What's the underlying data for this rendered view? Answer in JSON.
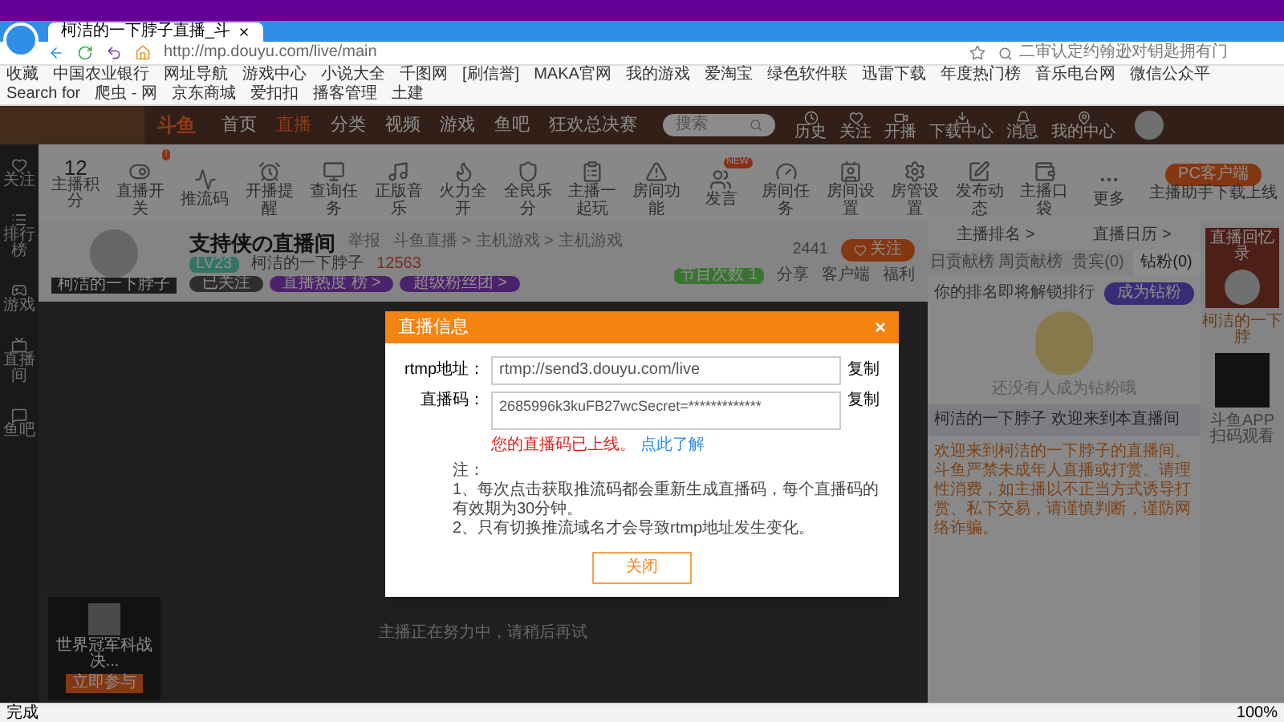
{
  "browser": {
    "tab_title": "柯洁的一下脖子直播_斗",
    "url": "http://mp.douyu.com/live/main",
    "search_placeholder": "二审认定约翰逊对钥匙拥有门",
    "bookmarks": [
      "收藏",
      "中国农业银行",
      "网址导航",
      "游戏中心",
      "小说大全",
      "千图网",
      "[刷信誉]",
      "MAKA官网",
      "我的游戏",
      "爱淘宝",
      "绿色软件联",
      "迅雷下载",
      "年度热门榜",
      "音乐电台网",
      "微信公众平",
      "Search for",
      "爬虫 - 网",
      "京东商城",
      "爱扣扣",
      "播客管理",
      "土建"
    ]
  },
  "site_header": {
    "logo_text": "斗鱼",
    "search_placeholder": "搜索",
    "nav": [
      {
        "label": "首页",
        "selected": false
      },
      {
        "label": "直播",
        "selected": true
      },
      {
        "label": "分类",
        "selected": false
      },
      {
        "label": "视频",
        "selected": false
      },
      {
        "label": "游戏",
        "selected": false
      },
      {
        "label": "鱼吧",
        "selected": false
      },
      {
        "label": "狂欢总决赛",
        "selected": false
      }
    ],
    "user_menu": [
      "历史",
      "关注",
      "开播",
      "下载中心",
      "消息",
      "我的中心"
    ]
  },
  "left_sidebar": [
    "关注",
    "排行榜",
    "游戏",
    "直播间",
    "鱼吧"
  ],
  "toolbar": {
    "items": [
      {
        "kind": "score",
        "value": "12",
        "label": "主播积分"
      },
      {
        "kind": "icon",
        "label": "直播开关",
        "badge": "!"
      },
      {
        "kind": "icon",
        "label": "推流码"
      },
      {
        "kind": "icon",
        "label": "开播提醒"
      },
      {
        "kind": "icon",
        "label": "查询任务"
      },
      {
        "kind": "icon",
        "label": "正版音乐"
      },
      {
        "kind": "icon",
        "label": "火力全开"
      },
      {
        "kind": "icon",
        "label": "全民乐分"
      },
      {
        "kind": "icon",
        "label": "主播一起玩"
      },
      {
        "kind": "icon",
        "label": "房间功能"
      },
      {
        "kind": "icon",
        "label": "发言",
        "badge": "NEW"
      },
      {
        "kind": "icon",
        "label": "房间任务"
      },
      {
        "kind": "icon",
        "label": "房间设置"
      },
      {
        "kind": "icon",
        "label": "房管设置"
      },
      {
        "kind": "icon",
        "label": "发布动态"
      },
      {
        "kind": "icon",
        "label": "主播口袋"
      },
      {
        "kind": "icon",
        "label": "更多"
      }
    ],
    "pc_client": {
      "button": "PC客户端",
      "caption": "主播助手下载上线"
    }
  },
  "room": {
    "title": "支持侠の直播间",
    "report": "举报",
    "breadcrumb": "斗鱼直播 > 主机游戏 > 主机游戏",
    "level": "LV23",
    "owner": "柯洁的一下脖子",
    "heat": "12563",
    "avatar_caption": "柯洁的一下脖子",
    "badges": [
      "已关注",
      "直播热度 榜 >",
      "超级粉丝团 >"
    ],
    "follow_count": "2441",
    "follow_button": "关注",
    "program_label": "节目次数",
    "program_count": "1",
    "actions": [
      "分享",
      "客户端",
      "福利"
    ]
  },
  "video": {
    "message": "主播正在努力中，请稍后再试"
  },
  "promo_card": {
    "title": "世界冠军科战决...",
    "button": "立即参与"
  },
  "dialog": {
    "title": "直播信息",
    "close": "×",
    "rtmp_label": "rtmp地址：",
    "rtmp_value": "rtmp://send3.douyu.com/live",
    "copy": "复制",
    "code_label": "直播码：",
    "code_value": "2685996k3kuFB27wcSecret=*************",
    "code_copy": "复制",
    "warning": "您的直播码已上线。",
    "warning_link": "点此了解",
    "notes": [
      "注：",
      "1、每次点击获取推流码都会重新生成直播码，每个直播码的有效期为30分钟。",
      "2、只有切换推流域名才会导致rtmp地址发生变化。"
    ],
    "button": "关闭"
  },
  "right_panel": {
    "links": [
      "主播排名 >",
      "直播日历 >"
    ],
    "tabs": [
      {
        "label": "日贡献榜",
        "selected": false
      },
      {
        "label": "周贡献榜",
        "selected": false
      },
      {
        "label": "贵宾(0)",
        "selected": false
      },
      {
        "label": "钻粉(0)",
        "selected": true
      }
    ],
    "heading": "你的排名即将解锁排行",
    "join_button": "成为钻粉",
    "empty_text": "还没有人成为钻粉哦",
    "chat": {
      "user": "柯洁的一下脖子",
      "message": "欢迎来到本直播间"
    },
    "notice": "欢迎来到柯洁的一下脖子的直播间。斗鱼严禁未成年人直播或打赏。请理性消费，如主播以不正当方式诱导打赏、私下交易，请谨慎判断，谨防网络诈骗。"
  },
  "side_ad": {
    "title": "直播回忆录",
    "caption": "柯洁的一下脖",
    "qr_caption": "斗鱼APP 扫码观看"
  },
  "status_bar": {
    "left": "完成",
    "zoom": "100%"
  }
}
